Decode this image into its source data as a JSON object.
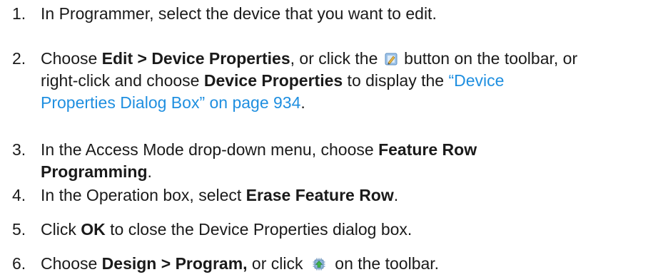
{
  "steps": [
    {
      "number": "1.",
      "text": "In Programmer, select the device that you want to edit."
    },
    {
      "number": "2.",
      "pre": "Choose ",
      "bold1": "Edit > Device Properties",
      "mid1": ", or click the ",
      "icon": "device-properties-icon",
      "mid2": " button on the toolbar, or",
      "line2_pre": "right-click and choose ",
      "bold2": "Device Properties",
      "line2_mid": " to display the ",
      "link1": "“Device",
      "link2": "Properties Dialog Box” on page 934",
      "end": "."
    },
    {
      "number": "3.",
      "pre": "In the Access Mode drop-down menu, choose ",
      "bold1": "Feature Row",
      "bold2": "Programming",
      "end": "."
    },
    {
      "number": "4.",
      "pre": "In the Operation box, select ",
      "bold": "Erase Feature Row",
      "end": "."
    },
    {
      "number": "5.",
      "pre": "Click ",
      "bold": "OK",
      "end": " to close the Device Properties dialog box."
    },
    {
      "number": "6.",
      "pre": "Choose ",
      "bold": "Design > Program,",
      "mid": " or click ",
      "icon": "program-icon",
      "end": " on the toolbar."
    }
  ]
}
